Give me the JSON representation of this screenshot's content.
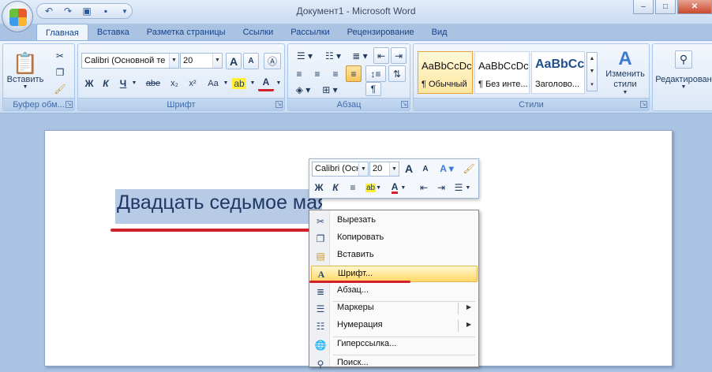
{
  "window": {
    "title": "Документ1 - Microsoft Word",
    "minimize_label": "–",
    "maximize_label": "□",
    "close_label": "✕"
  },
  "tabs": [
    {
      "label": "Главная",
      "active": true
    },
    {
      "label": "Вставка"
    },
    {
      "label": "Разметка страницы"
    },
    {
      "label": "Ссылки"
    },
    {
      "label": "Рассылки"
    },
    {
      "label": "Рецензирование"
    },
    {
      "label": "Вид"
    }
  ],
  "ribbon": {
    "clipboard": {
      "label": "Буфер обм...",
      "paste_label": "Вставить"
    },
    "font": {
      "label": "Шрифт",
      "font_name": "Calibri (Основной те",
      "font_size": "20",
      "bold": "Ж",
      "italic": "К",
      "underline": "Ч",
      "strike": "abe",
      "subscript": "x₂",
      "superscript": "x²",
      "change_case": "Aa",
      "grow": "A",
      "shrink": "A"
    },
    "paragraph": {
      "label": "Абзац"
    },
    "styles": {
      "label": "Стили",
      "items": [
        {
          "sample": "AaBbCcDc",
          "name": "¶ Обычный"
        },
        {
          "sample": "AaBbCcDc",
          "name": "¶ Без инте..."
        },
        {
          "sample": "AaBbCc",
          "name": "Заголово..."
        }
      ],
      "change_styles_label": "Изменить стили"
    },
    "editing": {
      "label": "Редактирован"
    }
  },
  "document": {
    "selected_text": "Двадцать седьмое мая"
  },
  "mini_toolbar": {
    "font_name": "Calibri (Осн",
    "font_size": "20",
    "bold": "Ж",
    "italic": "К"
  },
  "context_menu": {
    "items": [
      {
        "label": "Вырезать",
        "icon": "scissors-icon"
      },
      {
        "label": "Копировать",
        "icon": "copy-icon"
      },
      {
        "label": "Вставить",
        "icon": "paste-icon"
      },
      {
        "label": "Шрифт...",
        "icon": "font-icon",
        "highlighted": true
      },
      {
        "label": "Абзац...",
        "icon": "paragraph-icon"
      },
      {
        "label": "Маркеры",
        "icon": "bullets-icon",
        "submenu": true
      },
      {
        "label": "Нумерация",
        "icon": "numbering-icon",
        "submenu": true
      },
      {
        "label": "Гиперссылка...",
        "icon": "hyperlink-icon"
      },
      {
        "label": "Поиск...",
        "icon": "search-icon"
      }
    ]
  },
  "colors": {
    "annotation_red": "#d1202a",
    "highlight_yellow": "#ffd765",
    "selection_blue": "#b7cbe6"
  }
}
